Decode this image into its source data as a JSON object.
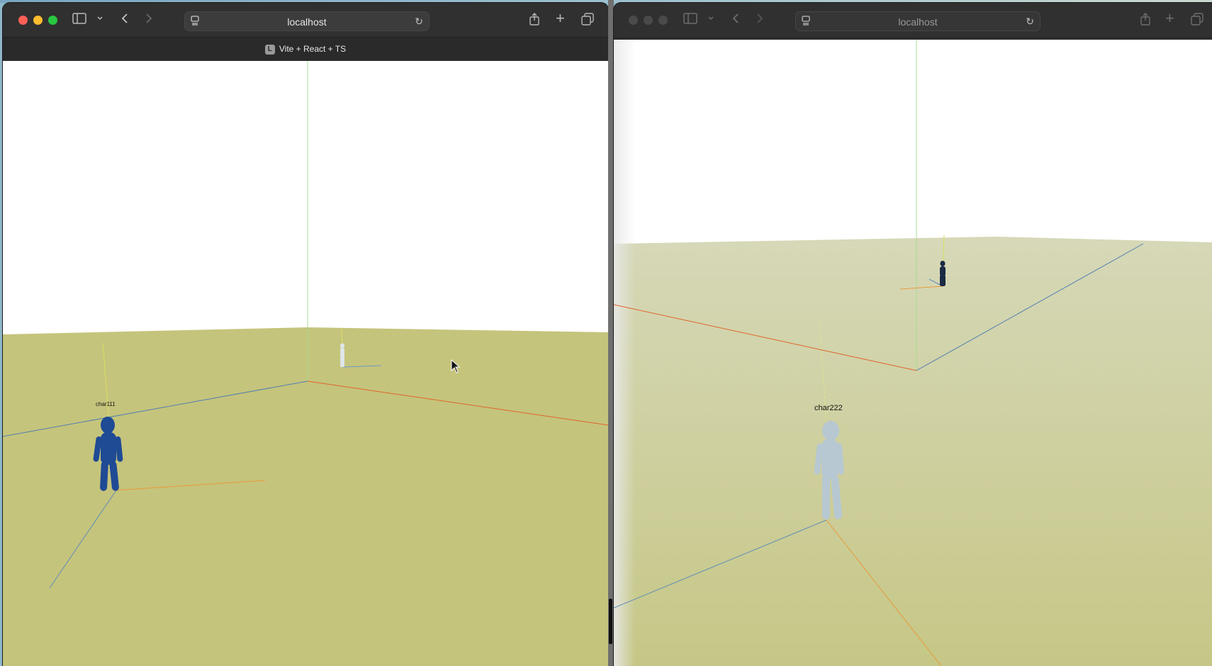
{
  "left_window": {
    "url": "localhost",
    "tab_title": "Vite + React + TS",
    "tab_favicon_letter": "L",
    "icons": [
      "sidebar-icon",
      "chevron-down-icon",
      "back-icon",
      "forward-icon",
      "page-menu-icon",
      "reload-icon",
      "share-icon",
      "new-tab-icon",
      "tabs-overview-icon"
    ],
    "scene": {
      "character_label": "char111"
    }
  },
  "right_window": {
    "url": "localhost",
    "scene": {
      "character_label": "char222"
    }
  },
  "colors": {
    "ground": "#c5c47c",
    "sky": "#ffffff",
    "character_blue": "#1f4a94",
    "character_pale": "#b7c8d2",
    "axis_x": "#e0642a",
    "axis_y": "#7ecb5a",
    "axis_z": "#4f7fb0"
  }
}
